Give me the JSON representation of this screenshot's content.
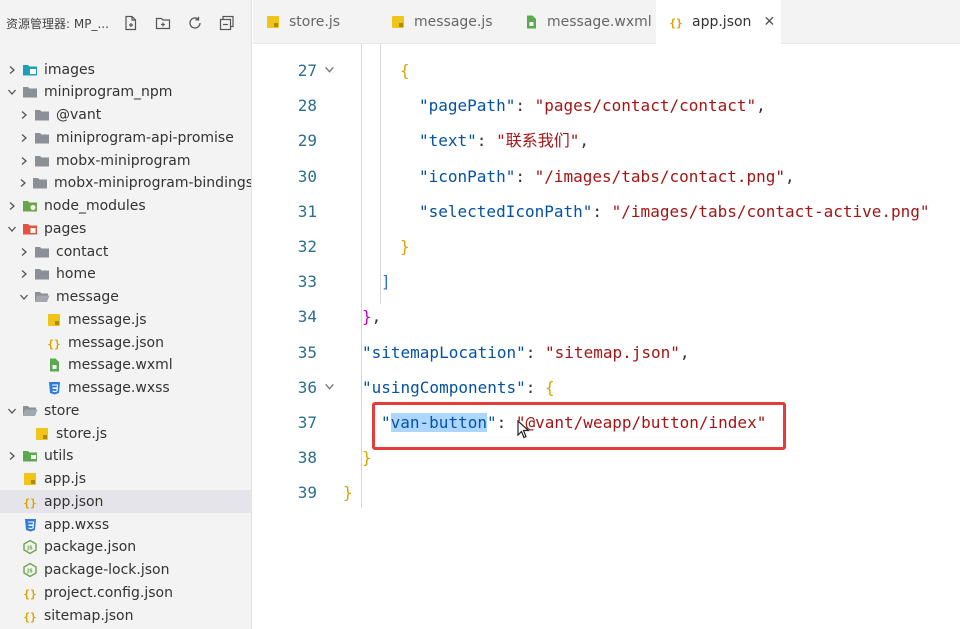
{
  "sidebar": {
    "title": "资源管理器: MP_...",
    "actions": [
      "new-file-icon",
      "new-folder-icon",
      "refresh-icon",
      "collapse-all-icon"
    ],
    "tree": [
      {
        "label": "images",
        "depth": 0,
        "chevron": "right",
        "icon": "folder-images"
      },
      {
        "label": "miniprogram_npm",
        "depth": 0,
        "chevron": "down",
        "icon": "folder"
      },
      {
        "label": "@vant",
        "depth": 1,
        "chevron": "right",
        "icon": "folder"
      },
      {
        "label": "miniprogram-api-promise",
        "depth": 1,
        "chevron": "right",
        "icon": "folder"
      },
      {
        "label": "mobx-miniprogram",
        "depth": 1,
        "chevron": "right",
        "icon": "folder"
      },
      {
        "label": "mobx-miniprogram-bindings",
        "depth": 1,
        "chevron": "right",
        "icon": "folder"
      },
      {
        "label": "node_modules",
        "depth": 0,
        "chevron": "right",
        "icon": "folder-node"
      },
      {
        "label": "pages",
        "depth": 0,
        "chevron": "down",
        "icon": "folder-pages"
      },
      {
        "label": "contact",
        "depth": 1,
        "chevron": "right",
        "icon": "folder"
      },
      {
        "label": "home",
        "depth": 1,
        "chevron": "right",
        "icon": "folder"
      },
      {
        "label": "message",
        "depth": 1,
        "chevron": "down",
        "icon": "folder-open"
      },
      {
        "label": "message.js",
        "depth": 2,
        "chevron": "",
        "icon": "js"
      },
      {
        "label": "message.json",
        "depth": 2,
        "chevron": "",
        "icon": "json"
      },
      {
        "label": "message.wxml",
        "depth": 2,
        "chevron": "",
        "icon": "wxml"
      },
      {
        "label": "message.wxss",
        "depth": 2,
        "chevron": "",
        "icon": "wxss"
      },
      {
        "label": "store",
        "depth": 0,
        "chevron": "down",
        "icon": "folder-open"
      },
      {
        "label": "store.js",
        "depth": 1,
        "chevron": "",
        "icon": "js"
      },
      {
        "label": "utils",
        "depth": 0,
        "chevron": "right",
        "icon": "folder-utils"
      },
      {
        "label": "app.js",
        "depth": 0,
        "chevron": "",
        "icon": "js"
      },
      {
        "label": "app.json",
        "depth": 0,
        "chevron": "",
        "icon": "json",
        "selected": true
      },
      {
        "label": "app.wxss",
        "depth": 0,
        "chevron": "",
        "icon": "wxss"
      },
      {
        "label": "package.json",
        "depth": 0,
        "chevron": "",
        "icon": "npm"
      },
      {
        "label": "package-lock.json",
        "depth": 0,
        "chevron": "",
        "icon": "npm"
      },
      {
        "label": "project.config.json",
        "depth": 0,
        "chevron": "",
        "icon": "json"
      },
      {
        "label": "sitemap.json",
        "depth": 0,
        "chevron": "",
        "icon": "json"
      }
    ]
  },
  "tabs": [
    {
      "label": "store.js",
      "icon": "js",
      "active": false
    },
    {
      "label": "message.js",
      "icon": "js",
      "active": false
    },
    {
      "label": "message.wxml",
      "icon": "wxml",
      "active": false
    },
    {
      "label": "app.json",
      "icon": "json",
      "active": true,
      "close": "✕"
    }
  ],
  "editor": {
    "lines": [
      {
        "num": "27",
        "fold": true,
        "indent": 3,
        "tokens": [
          {
            "t": "{",
            "c": "b1"
          }
        ]
      },
      {
        "num": "28",
        "fold": false,
        "indent": 4,
        "tokens": [
          {
            "t": "\"pagePath\"",
            "c": "k"
          },
          {
            "t": ": ",
            "c": "p"
          },
          {
            "t": "\"pages/contact/contact\"",
            "c": "s"
          },
          {
            "t": ",",
            "c": "p"
          }
        ]
      },
      {
        "num": "29",
        "fold": false,
        "indent": 4,
        "tokens": [
          {
            "t": "\"text\"",
            "c": "k"
          },
          {
            "t": ": ",
            "c": "p"
          },
          {
            "t": "\"联系我们\"",
            "c": "s"
          },
          {
            "t": ",",
            "c": "p"
          }
        ]
      },
      {
        "num": "30",
        "fold": false,
        "indent": 4,
        "tokens": [
          {
            "t": "\"iconPath\"",
            "c": "k"
          },
          {
            "t": ": ",
            "c": "p"
          },
          {
            "t": "\"/images/tabs/contact.png\"",
            "c": "s"
          },
          {
            "t": ",",
            "c": "p"
          }
        ]
      },
      {
        "num": "31",
        "fold": false,
        "indent": 4,
        "tokens": [
          {
            "t": "\"selectedIconPath\"",
            "c": "k"
          },
          {
            "t": ": ",
            "c": "p"
          },
          {
            "t": "\"/images/tabs/contact-active.png\"",
            "c": "s"
          }
        ]
      },
      {
        "num": "32",
        "fold": false,
        "indent": 3,
        "tokens": [
          {
            "t": "}",
            "c": "b1"
          }
        ]
      },
      {
        "num": "33",
        "fold": false,
        "indent": 2,
        "tokens": [
          {
            "t": "]",
            "c": "b3"
          }
        ]
      },
      {
        "num": "34",
        "fold": false,
        "indent": 1,
        "tokens": [
          {
            "t": "}",
            "c": "b4"
          },
          {
            "t": ",",
            "c": "p"
          }
        ]
      },
      {
        "num": "35",
        "fold": false,
        "indent": 1,
        "tokens": [
          {
            "t": "\"sitemapLocation\"",
            "c": "k"
          },
          {
            "t": ": ",
            "c": "p"
          },
          {
            "t": "\"sitemap.json\"",
            "c": "s"
          },
          {
            "t": ",",
            "c": "p"
          }
        ]
      },
      {
        "num": "36",
        "fold": true,
        "indent": 1,
        "tokens": [
          {
            "t": "\"usingComponents\"",
            "c": "k"
          },
          {
            "t": ": ",
            "c": "p"
          },
          {
            "t": "{",
            "c": "b1"
          }
        ]
      },
      {
        "num": "37",
        "fold": false,
        "indent": 2,
        "tokens": [
          {
            "t": "\"",
            "c": "k"
          },
          {
            "t": "van-button",
            "c": "k sel"
          },
          {
            "t": "\"",
            "c": "k"
          },
          {
            "t": ": ",
            "c": "p"
          },
          {
            "t": "\"@vant/weapp/button/index\"",
            "c": "s"
          }
        ]
      },
      {
        "num": "38",
        "fold": false,
        "indent": 1,
        "tokens": [
          {
            "t": "}",
            "c": "b1"
          }
        ]
      },
      {
        "num": "39",
        "fold": false,
        "indent": 0,
        "tokens": [
          {
            "t": "}",
            "c": "b1"
          }
        ]
      }
    ]
  },
  "colors": {
    "annotation": "#e53b3b",
    "selection": "#add6ff",
    "line_number": "#2b6f8f"
  }
}
